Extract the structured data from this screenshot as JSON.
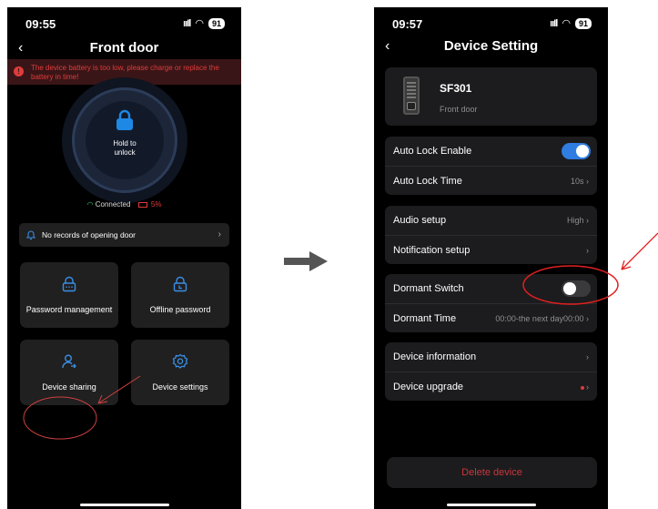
{
  "left_screen": {
    "status": {
      "time": "09:55",
      "battery": "91"
    },
    "nav": {
      "back": "‹",
      "title": "Front door"
    },
    "alert": {
      "text": "The device battery is too low, please charge or replace the battery in time!"
    },
    "unlock": {
      "label_line1": "Hold to",
      "label_line2": "unlock"
    },
    "connection": {
      "status": "Connected",
      "battery_pct": "5%"
    },
    "records": {
      "text": "No records of opening door",
      "chevron": "›"
    },
    "tiles": {
      "password": "Password management",
      "offline": "Offline password",
      "sharing": "Device sharing",
      "settings": "Device settings"
    }
  },
  "right_screen": {
    "status": {
      "time": "09:57",
      "battery": "91"
    },
    "nav": {
      "back": "‹",
      "title": "Device Setting"
    },
    "device": {
      "model": "SF301",
      "location": "Front door"
    },
    "auto_lock": {
      "enable_label": "Auto Lock Enable",
      "enabled": true,
      "time_label": "Auto Lock Time",
      "time_value": "10s"
    },
    "audio": {
      "label": "Audio setup",
      "value": "High"
    },
    "notification": {
      "label": "Notification setup"
    },
    "dormant": {
      "switch_label": "Dormant Switch",
      "enabled": false,
      "time_label": "Dormant Time",
      "time_value": "00:00-the next day00:00"
    },
    "device_info": {
      "label": "Device information"
    },
    "upgrade": {
      "label": "Device upgrade"
    },
    "chevron": "›",
    "delete_label": "Delete device"
  },
  "colors": {
    "accent_blue": "#2f7de1",
    "alert_red": "#e03b3b",
    "annotation_red": "#e02020",
    "ok_green": "#2ecc71"
  }
}
